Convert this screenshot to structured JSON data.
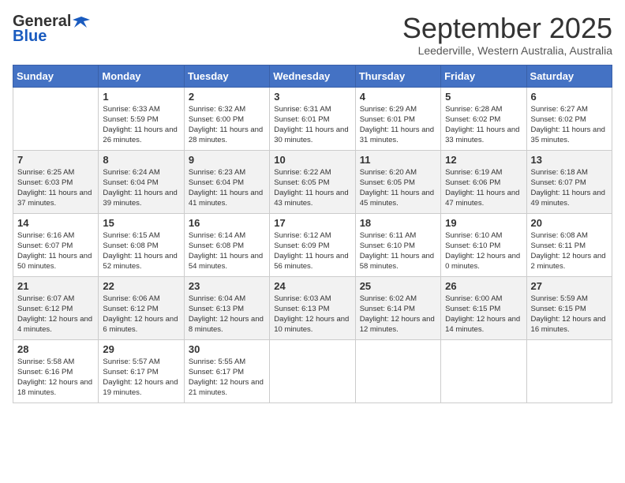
{
  "header": {
    "logo_general": "General",
    "logo_blue": "Blue",
    "month_title": "September 2025",
    "location": "Leederville, Western Australia, Australia"
  },
  "columns": [
    "Sunday",
    "Monday",
    "Tuesday",
    "Wednesday",
    "Thursday",
    "Friday",
    "Saturday"
  ],
  "weeks": [
    [
      {
        "day": "",
        "sunrise": "",
        "sunset": "",
        "daylight": ""
      },
      {
        "day": "1",
        "sunrise": "Sunrise: 6:33 AM",
        "sunset": "Sunset: 5:59 PM",
        "daylight": "Daylight: 11 hours and 26 minutes."
      },
      {
        "day": "2",
        "sunrise": "Sunrise: 6:32 AM",
        "sunset": "Sunset: 6:00 PM",
        "daylight": "Daylight: 11 hours and 28 minutes."
      },
      {
        "day": "3",
        "sunrise": "Sunrise: 6:31 AM",
        "sunset": "Sunset: 6:01 PM",
        "daylight": "Daylight: 11 hours and 30 minutes."
      },
      {
        "day": "4",
        "sunrise": "Sunrise: 6:29 AM",
        "sunset": "Sunset: 6:01 PM",
        "daylight": "Daylight: 11 hours and 31 minutes."
      },
      {
        "day": "5",
        "sunrise": "Sunrise: 6:28 AM",
        "sunset": "Sunset: 6:02 PM",
        "daylight": "Daylight: 11 hours and 33 minutes."
      },
      {
        "day": "6",
        "sunrise": "Sunrise: 6:27 AM",
        "sunset": "Sunset: 6:02 PM",
        "daylight": "Daylight: 11 hours and 35 minutes."
      }
    ],
    [
      {
        "day": "7",
        "sunrise": "Sunrise: 6:25 AM",
        "sunset": "Sunset: 6:03 PM",
        "daylight": "Daylight: 11 hours and 37 minutes."
      },
      {
        "day": "8",
        "sunrise": "Sunrise: 6:24 AM",
        "sunset": "Sunset: 6:04 PM",
        "daylight": "Daylight: 11 hours and 39 minutes."
      },
      {
        "day": "9",
        "sunrise": "Sunrise: 6:23 AM",
        "sunset": "Sunset: 6:04 PM",
        "daylight": "Daylight: 11 hours and 41 minutes."
      },
      {
        "day": "10",
        "sunrise": "Sunrise: 6:22 AM",
        "sunset": "Sunset: 6:05 PM",
        "daylight": "Daylight: 11 hours and 43 minutes."
      },
      {
        "day": "11",
        "sunrise": "Sunrise: 6:20 AM",
        "sunset": "Sunset: 6:05 PM",
        "daylight": "Daylight: 11 hours and 45 minutes."
      },
      {
        "day": "12",
        "sunrise": "Sunrise: 6:19 AM",
        "sunset": "Sunset: 6:06 PM",
        "daylight": "Daylight: 11 hours and 47 minutes."
      },
      {
        "day": "13",
        "sunrise": "Sunrise: 6:18 AM",
        "sunset": "Sunset: 6:07 PM",
        "daylight": "Daylight: 11 hours and 49 minutes."
      }
    ],
    [
      {
        "day": "14",
        "sunrise": "Sunrise: 6:16 AM",
        "sunset": "Sunset: 6:07 PM",
        "daylight": "Daylight: 11 hours and 50 minutes."
      },
      {
        "day": "15",
        "sunrise": "Sunrise: 6:15 AM",
        "sunset": "Sunset: 6:08 PM",
        "daylight": "Daylight: 11 hours and 52 minutes."
      },
      {
        "day": "16",
        "sunrise": "Sunrise: 6:14 AM",
        "sunset": "Sunset: 6:08 PM",
        "daylight": "Daylight: 11 hours and 54 minutes."
      },
      {
        "day": "17",
        "sunrise": "Sunrise: 6:12 AM",
        "sunset": "Sunset: 6:09 PM",
        "daylight": "Daylight: 11 hours and 56 minutes."
      },
      {
        "day": "18",
        "sunrise": "Sunrise: 6:11 AM",
        "sunset": "Sunset: 6:10 PM",
        "daylight": "Daylight: 11 hours and 58 minutes."
      },
      {
        "day": "19",
        "sunrise": "Sunrise: 6:10 AM",
        "sunset": "Sunset: 6:10 PM",
        "daylight": "Daylight: 12 hours and 0 minutes."
      },
      {
        "day": "20",
        "sunrise": "Sunrise: 6:08 AM",
        "sunset": "Sunset: 6:11 PM",
        "daylight": "Daylight: 12 hours and 2 minutes."
      }
    ],
    [
      {
        "day": "21",
        "sunrise": "Sunrise: 6:07 AM",
        "sunset": "Sunset: 6:12 PM",
        "daylight": "Daylight: 12 hours and 4 minutes."
      },
      {
        "day": "22",
        "sunrise": "Sunrise: 6:06 AM",
        "sunset": "Sunset: 6:12 PM",
        "daylight": "Daylight: 12 hours and 6 minutes."
      },
      {
        "day": "23",
        "sunrise": "Sunrise: 6:04 AM",
        "sunset": "Sunset: 6:13 PM",
        "daylight": "Daylight: 12 hours and 8 minutes."
      },
      {
        "day": "24",
        "sunrise": "Sunrise: 6:03 AM",
        "sunset": "Sunset: 6:13 PM",
        "daylight": "Daylight: 12 hours and 10 minutes."
      },
      {
        "day": "25",
        "sunrise": "Sunrise: 6:02 AM",
        "sunset": "Sunset: 6:14 PM",
        "daylight": "Daylight: 12 hours and 12 minutes."
      },
      {
        "day": "26",
        "sunrise": "Sunrise: 6:00 AM",
        "sunset": "Sunset: 6:15 PM",
        "daylight": "Daylight: 12 hours and 14 minutes."
      },
      {
        "day": "27",
        "sunrise": "Sunrise: 5:59 AM",
        "sunset": "Sunset: 6:15 PM",
        "daylight": "Daylight: 12 hours and 16 minutes."
      }
    ],
    [
      {
        "day": "28",
        "sunrise": "Sunrise: 5:58 AM",
        "sunset": "Sunset: 6:16 PM",
        "daylight": "Daylight: 12 hours and 18 minutes."
      },
      {
        "day": "29",
        "sunrise": "Sunrise: 5:57 AM",
        "sunset": "Sunset: 6:17 PM",
        "daylight": "Daylight: 12 hours and 19 minutes."
      },
      {
        "day": "30",
        "sunrise": "Sunrise: 5:55 AM",
        "sunset": "Sunset: 6:17 PM",
        "daylight": "Daylight: 12 hours and 21 minutes."
      },
      {
        "day": "",
        "sunrise": "",
        "sunset": "",
        "daylight": ""
      },
      {
        "day": "",
        "sunrise": "",
        "sunset": "",
        "daylight": ""
      },
      {
        "day": "",
        "sunrise": "",
        "sunset": "",
        "daylight": ""
      },
      {
        "day": "",
        "sunrise": "",
        "sunset": "",
        "daylight": ""
      }
    ]
  ]
}
